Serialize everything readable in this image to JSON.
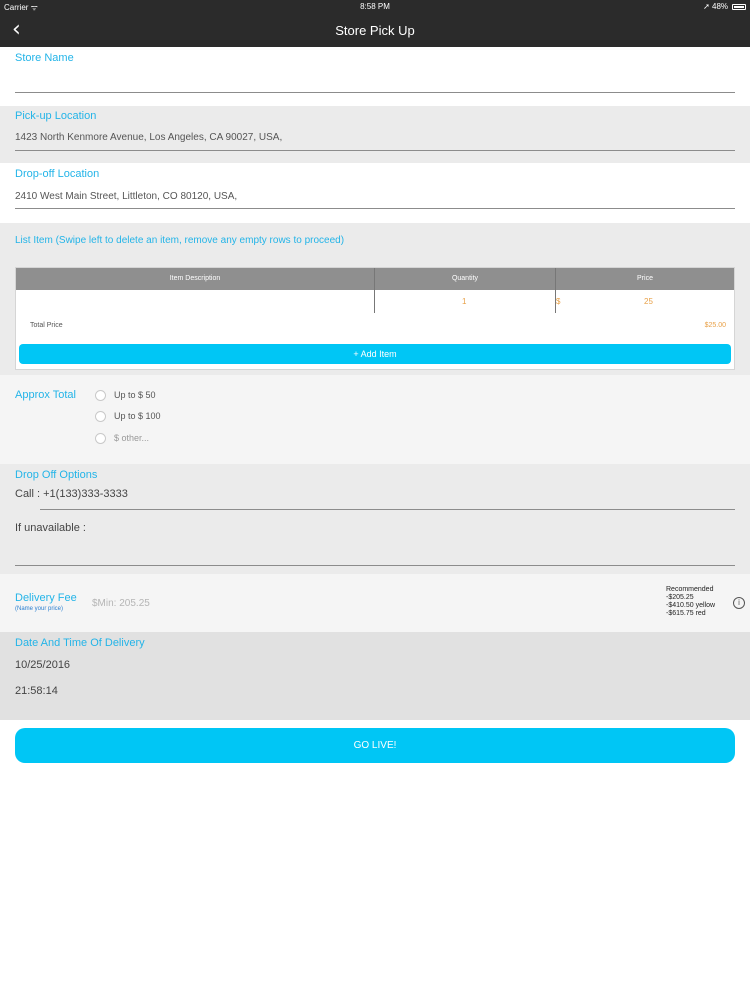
{
  "status_bar": {
    "carrier": "Carrier ᯤ",
    "time": "8:58 PM",
    "battery": "➚ 48%"
  },
  "nav": {
    "back_glyph": "‹",
    "title": "Store Pick Up"
  },
  "store_name": {
    "label": "Store Name",
    "value": ""
  },
  "pickup": {
    "label": "Pick-up Location",
    "value": "1423 North Kenmore Avenue, Los Angeles, CA 90027, USA,"
  },
  "dropoff": {
    "label": "Drop-off Location",
    "value": "2410 West Main Street, Littleton, CO 80120, USA,"
  },
  "list_items": {
    "label": "List Item (Swipe left to delete an item, remove any empty rows to proceed)",
    "columns": [
      "Item Description",
      "Quantity",
      "Price"
    ],
    "rows": [
      {
        "description": "",
        "quantity": "1",
        "currency": "$",
        "price": "25"
      }
    ],
    "total_label": "Total Price",
    "total_value": "$25.00",
    "add_button": "+ Add Item"
  },
  "approx_total": {
    "label": "Approx Total",
    "options": [
      "Up to $ 50",
      "Up to $ 100",
      "$ other..."
    ]
  },
  "dropoff_options": {
    "label": "Drop Off Options",
    "call": "Call : +1(133)333-3333",
    "unavailable_label": "If unavailable :"
  },
  "delivery_fee": {
    "label": "Delivery Fee",
    "sublabel": "(Name your price)",
    "placeholder": "$Min: 205.25",
    "recommended": [
      "Recommended",
      "-$205.25",
      "-$410.50 yellow",
      "-$615.75 red"
    ],
    "info_glyph": "i"
  },
  "date_time": {
    "label": "Date And Time Of Delivery",
    "date": "10/25/2016",
    "time": "21:58:14"
  },
  "go_live": "GO LIVE!",
  "colors": {
    "accent": "#00c6f5",
    "label_blue": "#23b4e8",
    "dark_bar": "#2b2b2b",
    "price_orange": "#e8a047"
  }
}
